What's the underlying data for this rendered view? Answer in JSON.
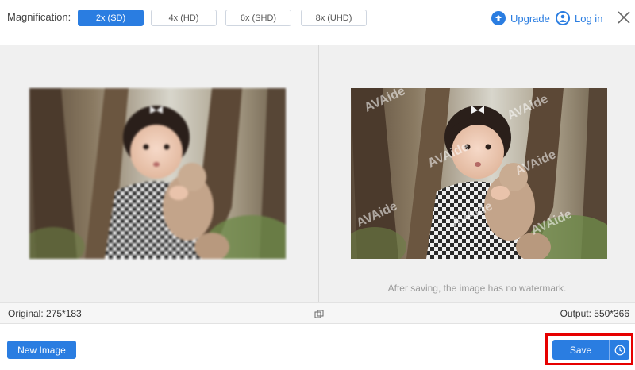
{
  "topbar": {
    "magnification_label": "Magnification:",
    "options": [
      "2x (SD)",
      "4x (HD)",
      "6x (SHD)",
      "8x (UHD)"
    ],
    "selected": "2x (SD)",
    "upgrade_label": "Upgrade",
    "login_label": "Log in"
  },
  "preview": {
    "watermark_text": "AVAide",
    "watermark_note": "After saving, the image has no watermark."
  },
  "info": {
    "original": "Original: 275*183",
    "output": "Output: 550*366"
  },
  "bottom": {
    "new_image_label": "New Image",
    "save_label": "Save"
  },
  "colors": {
    "accent": "#2a7de1",
    "highlight": "#e60000"
  },
  "icons": [
    "upgrade-arrow-icon",
    "user-icon",
    "close-icon",
    "compare-icon",
    "clock-icon"
  ]
}
